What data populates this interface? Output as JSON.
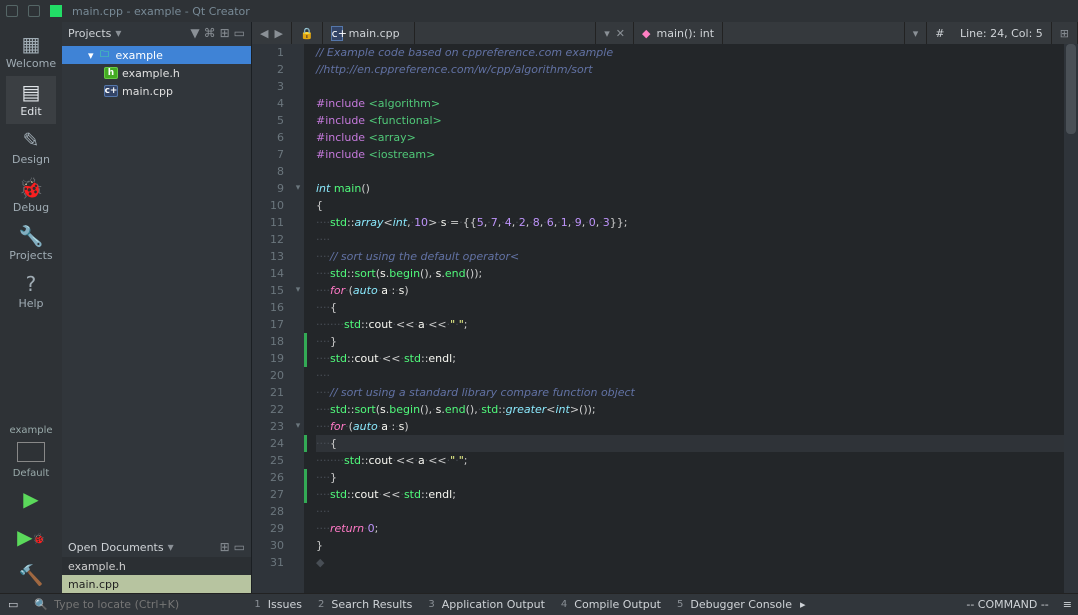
{
  "window_title": "main.cpp - example - Qt Creator",
  "left_sidebar": {
    "items": [
      {
        "label": "Welcome",
        "icon": "grid-icon"
      },
      {
        "label": "Edit",
        "icon": "doc-icon",
        "active": true
      },
      {
        "label": "Design",
        "icon": "pencil-icon"
      },
      {
        "label": "Debug",
        "icon": "bug-icon"
      },
      {
        "label": "Projects",
        "icon": "wrench-icon"
      },
      {
        "label": "Help",
        "icon": "help-icon"
      }
    ],
    "project_name": "example",
    "project_config": "Default"
  },
  "projects_pane": {
    "header": "Projects",
    "tree": [
      {
        "label": "example",
        "kind": "folder",
        "selected": true,
        "depth": 0
      },
      {
        "label": "example.h",
        "kind": "h",
        "depth": 1
      },
      {
        "label": "main.cpp",
        "kind": "cpp",
        "depth": 1
      }
    ]
  },
  "open_documents": {
    "header": "Open Documents",
    "items": [
      {
        "label": "example.h",
        "selected": false
      },
      {
        "label": "main.cpp",
        "selected": true
      }
    ]
  },
  "editor_tabbar": {
    "filename": "main.cpp",
    "symbol": "main(): int",
    "nav_line": "Line: 24, Col: 5",
    "hash": "#"
  },
  "code_lines": [
    {
      "n": 1,
      "t": "cmt",
      "txt": "// Example code based on cppreference.com example"
    },
    {
      "n": 2,
      "t": "cmt",
      "txt": "//http://en.cppreference.com/w/cpp/algorithm/sort"
    },
    {
      "n": 3,
      "t": "blank",
      "txt": ""
    },
    {
      "n": 4,
      "t": "inc",
      "a": "#include ",
      "b": "<algorithm>"
    },
    {
      "n": 5,
      "t": "inc",
      "a": "#include ",
      "b": "<functional>"
    },
    {
      "n": 6,
      "t": "inc",
      "a": "#include ",
      "b": "<array>"
    },
    {
      "n": 7,
      "t": "inc",
      "a": "#include ",
      "b": "<iostream>"
    },
    {
      "n": 8,
      "t": "blank",
      "txt": ""
    },
    {
      "n": 9,
      "t": "fnsig",
      "fold": true
    },
    {
      "n": 10,
      "t": "brace",
      "txt": "{"
    },
    {
      "n": 11,
      "t": "arr"
    },
    {
      "n": 12,
      "t": "blank",
      "ws": 4
    },
    {
      "n": 13,
      "t": "cmt2",
      "txt": "// sort using the default operator<",
      "ws": 4
    },
    {
      "n": 14,
      "t": "sort1"
    },
    {
      "n": 15,
      "t": "for",
      "fold": true
    },
    {
      "n": 16,
      "t": "brace2",
      "txt": "{",
      "ws": 4
    },
    {
      "n": 17,
      "t": "cout_a",
      "ws": 8
    },
    {
      "n": 18,
      "t": "brace2",
      "txt": "}",
      "ws": 4,
      "mark": true
    },
    {
      "n": 19,
      "t": "cout_endl",
      "ws": 4,
      "mark": true
    },
    {
      "n": 20,
      "t": "blank",
      "ws": 4
    },
    {
      "n": 21,
      "t": "cmt2",
      "txt": "// sort using a standard library compare function object",
      "ws": 4
    },
    {
      "n": 22,
      "t": "sort2"
    },
    {
      "n": 23,
      "t": "for",
      "fold": true
    },
    {
      "n": 24,
      "t": "brace2",
      "txt": "{",
      "ws": 4,
      "cur": true,
      "mark": true
    },
    {
      "n": 25,
      "t": "cout_a",
      "ws": 8
    },
    {
      "n": 26,
      "t": "brace2",
      "txt": "}",
      "ws": 4,
      "mark": true
    },
    {
      "n": 27,
      "t": "cout_endl",
      "ws": 4,
      "mark": true
    },
    {
      "n": 28,
      "t": "blank",
      "ws": 4
    },
    {
      "n": 29,
      "t": "return"
    },
    {
      "n": 30,
      "t": "brace",
      "txt": "}"
    },
    {
      "n": 31,
      "t": "eof"
    }
  ],
  "bottom": {
    "locator_placeholder": "Type to locate (Ctrl+K)",
    "panes": [
      {
        "n": "1",
        "label": "Issues"
      },
      {
        "n": "2",
        "label": "Search Results"
      },
      {
        "n": "3",
        "label": "Application Output"
      },
      {
        "n": "4",
        "label": "Compile Output"
      },
      {
        "n": "5",
        "label": "Debugger Console"
      }
    ],
    "mode": "-- COMMAND --"
  }
}
